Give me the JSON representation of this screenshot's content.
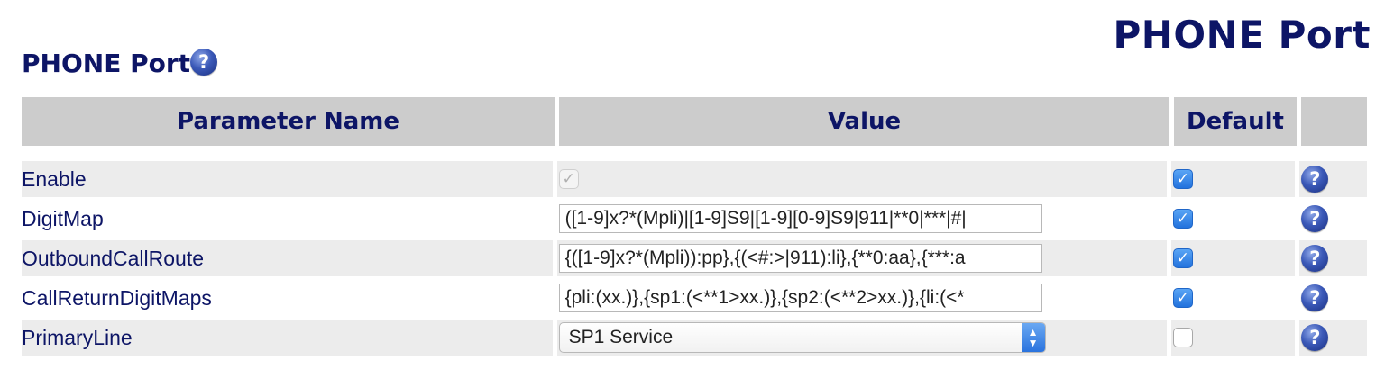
{
  "page": {
    "title": "PHONE Port"
  },
  "section": {
    "title": "PHONE Port",
    "help_glyph": "?"
  },
  "table": {
    "headers": {
      "parameter": "Parameter Name",
      "value": "Value",
      "default": "Default",
      "help": ""
    },
    "rows": [
      {
        "name": "Enable",
        "type": "checkbox",
        "checked": true,
        "disabled": true,
        "default_checked": true,
        "help_glyph": "?"
      },
      {
        "name": "DigitMap",
        "type": "text",
        "value": "([1-9]x?*(Mpli)|[1-9]S9|[1-9][0-9]S9|911|**0|***|#|",
        "default_checked": true,
        "help_glyph": "?"
      },
      {
        "name": "OutboundCallRoute",
        "type": "text",
        "value": "{([1-9]x?*(Mpli)):pp},{(<#:>|911):li},{**0:aa},{***:a",
        "default_checked": true,
        "help_glyph": "?"
      },
      {
        "name": "CallReturnDigitMaps",
        "type": "text",
        "value": "{pli:(xx.)},{sp1:(<**1>xx.)},{sp2:(<**2>xx.)},{li:(<*",
        "default_checked": true,
        "help_glyph": "?"
      },
      {
        "name": "PrimaryLine",
        "type": "select",
        "value": "SP1 Service",
        "default_checked": false,
        "help_glyph": "?"
      }
    ]
  },
  "icons": {
    "help": "help-question-icon",
    "checkmark": "✓",
    "select_up": "▲",
    "select_down": "▼"
  },
  "colors": {
    "title_navy": "#0d1566",
    "header_gray": "#cccccc",
    "row_shade": "#ececec",
    "checkbox_blue": "#2272dd"
  }
}
